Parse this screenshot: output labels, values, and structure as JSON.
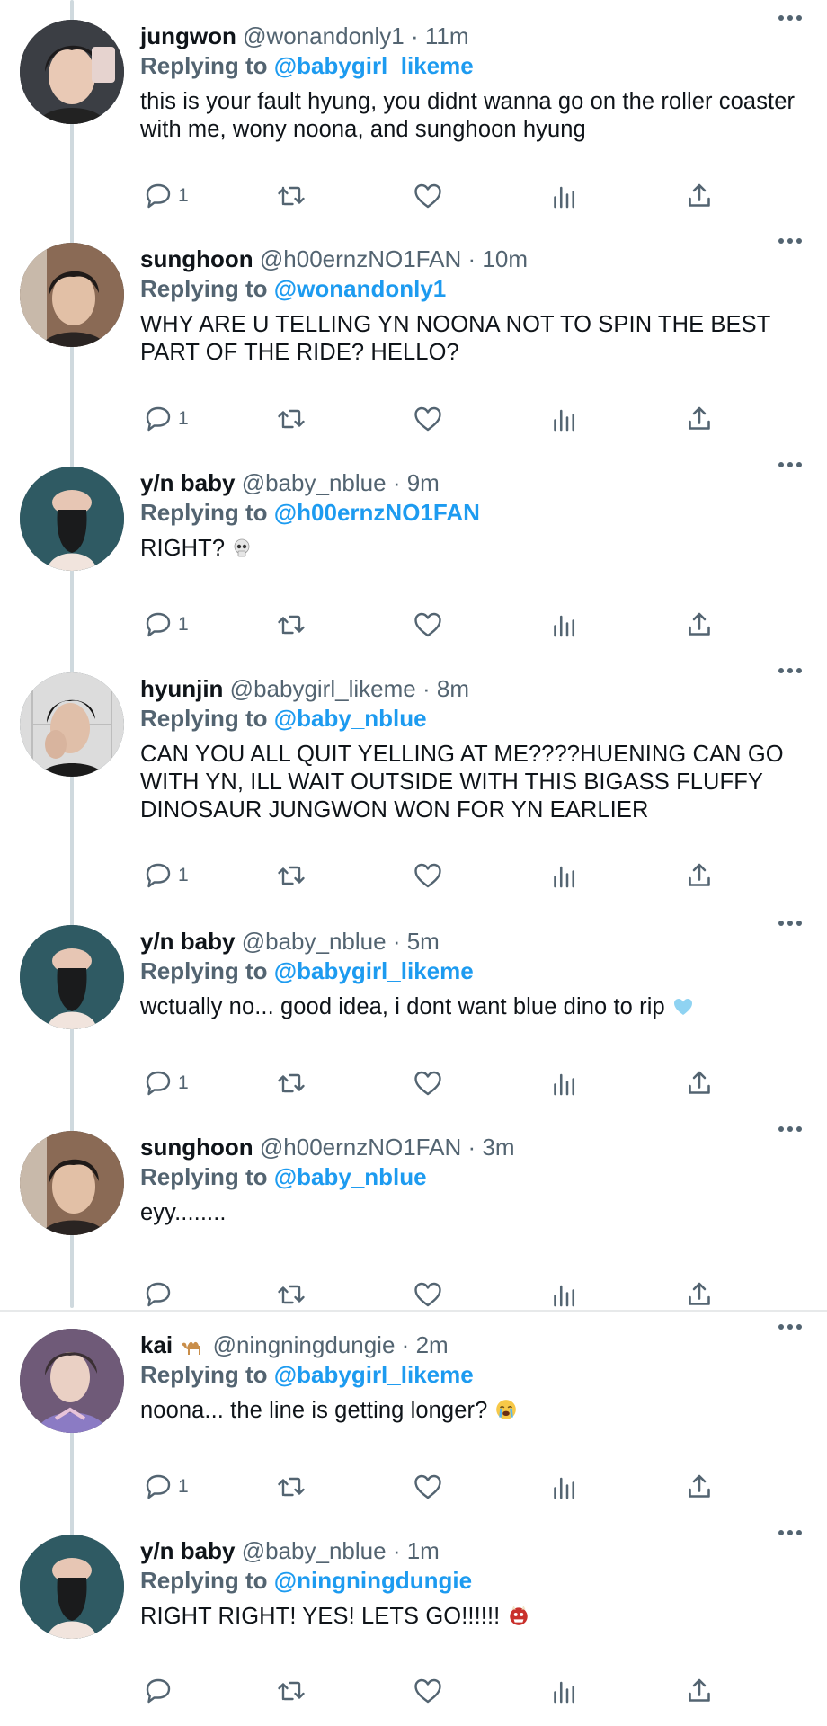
{
  "tweets": [
    {
      "name": "jungwon",
      "handle": "@wonandonly1",
      "time": "11m",
      "reply_label": "Replying to",
      "reply_to": "@babygirl_likeme",
      "text": "this is your fault hyung, you didnt wanna go on the roller coaster with me, wony noona, and sunghoon hyung",
      "reply_count": "1",
      "avatar": "person-dark-hair"
    },
    {
      "name": "sunghoon",
      "handle": "@h00ernzNO1FAN",
      "time": "10m",
      "reply_label": "Replying to",
      "reply_to": "@wonandonly1",
      "text": "WHY ARE U TELLING YN NOONA NOT TO SPIN THE BEST PART OF THE RIDE? HELLO?",
      "reply_count": "1",
      "avatar": "person-portrait"
    },
    {
      "name": "y/n baby",
      "handle": "@baby_nblue",
      "time": "9m",
      "reply_label": "Replying to",
      "reply_to": "@h00ernzNO1FAN",
      "text": "RIGHT?",
      "reply_count": "1",
      "avatar": "person-bucket-hat",
      "emoji": "skull-emoji"
    },
    {
      "name": "hyunjin",
      "handle": "@babygirl_likeme",
      "time": "8m",
      "reply_label": "Replying to",
      "reply_to": "@baby_nblue",
      "text": "CAN YOU ALL QUIT YELLING AT ME????HUENING CAN GO WITH YN, ILL WAIT OUTSIDE WITH THIS BIGASS FLUFFY DINOSAUR JUNGWON WON FOR YN EARLIER",
      "reply_count": "1",
      "avatar": "person-hand-face"
    },
    {
      "name": "y/n baby",
      "handle": "@baby_nblue",
      "time": "5m",
      "reply_label": "Replying to",
      "reply_to": "@babygirl_likeme",
      "text": "wctually no... good idea, i dont want blue dino to rip",
      "reply_count": "1",
      "avatar": "person-bucket-hat",
      "emoji": "light-blue-heart-emoji"
    },
    {
      "name": "sunghoon",
      "handle": "@h00ernzNO1FAN",
      "time": "3m",
      "reply_label": "Replying to",
      "reply_to": "@baby_nblue",
      "text": "eyy........",
      "reply_count": "",
      "avatar": "person-portrait"
    },
    {
      "name": "kai",
      "handle": "@ningningdungie",
      "time": "2m",
      "reply_label": "Replying to",
      "reply_to": "@babygirl_likeme",
      "text": "noona... the line is getting longer?",
      "reply_count": "1",
      "avatar": "person-purple-shirt",
      "name_emoji": "camel-emoji",
      "emoji": "crying-face-emoji"
    },
    {
      "name": "y/n baby",
      "handle": "@baby_nblue",
      "time": "1m",
      "reply_label": "Replying to",
      "reply_to": "@ningningdungie",
      "text": "RIGHT RIGHT! YES! LETS GO!!!!!!",
      "reply_count": "",
      "avatar": "person-bucket-hat",
      "emoji": "ogre-mask-emoji"
    }
  ],
  "separator": "·",
  "colors": {
    "link": "#1d9bf0",
    "secondary": "#536471",
    "text": "#0f1419",
    "thread_line": "#cfd9de"
  }
}
